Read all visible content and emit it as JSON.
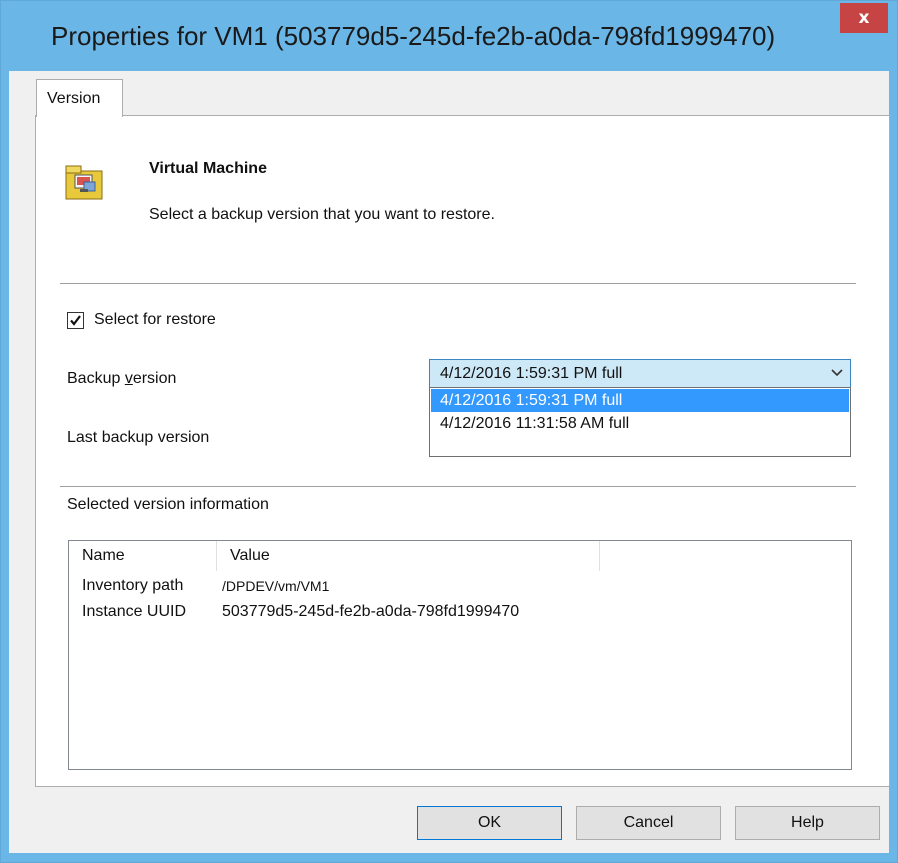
{
  "window": {
    "title": "Properties for VM1 (503779d5-245d-fe2b-a0da-798fd1999470)",
    "close_glyph": "x"
  },
  "tabs": [
    {
      "label": "Version",
      "active": true
    }
  ],
  "header": {
    "icon": "virtual-machine-folder-icon",
    "title": "Virtual Machine",
    "description": "Select a backup version that you want to restore."
  },
  "restore": {
    "checkbox_label": "Select for restore",
    "checked": true
  },
  "backup_version": {
    "label_pre": "Backup ",
    "label_access": "v",
    "label_post": "ersion",
    "selected": "4/12/2016 1:59:31 PM full",
    "options": [
      "4/12/2016 1:59:31 PM full",
      "4/12/2016 11:31:58 AM full"
    ],
    "selected_color": "#3399ff"
  },
  "last_backup_label": "Last backup version",
  "info": {
    "title": "Selected version information",
    "columns": [
      "Name",
      "Value"
    ],
    "rows": [
      {
        "name": "Inventory path",
        "value": "/DPDEV/vm/VM1"
      },
      {
        "name": "Instance UUID",
        "value": "503779d5-245d-fe2b-a0da-798fd1999470"
      }
    ]
  },
  "buttons": {
    "ok": "OK",
    "cancel": "Cancel",
    "help": "Help"
  },
  "colors": {
    "title_bar": "#6ab6e6",
    "close_button": "#c74444",
    "dialog_bg": "#f0f0f0"
  }
}
